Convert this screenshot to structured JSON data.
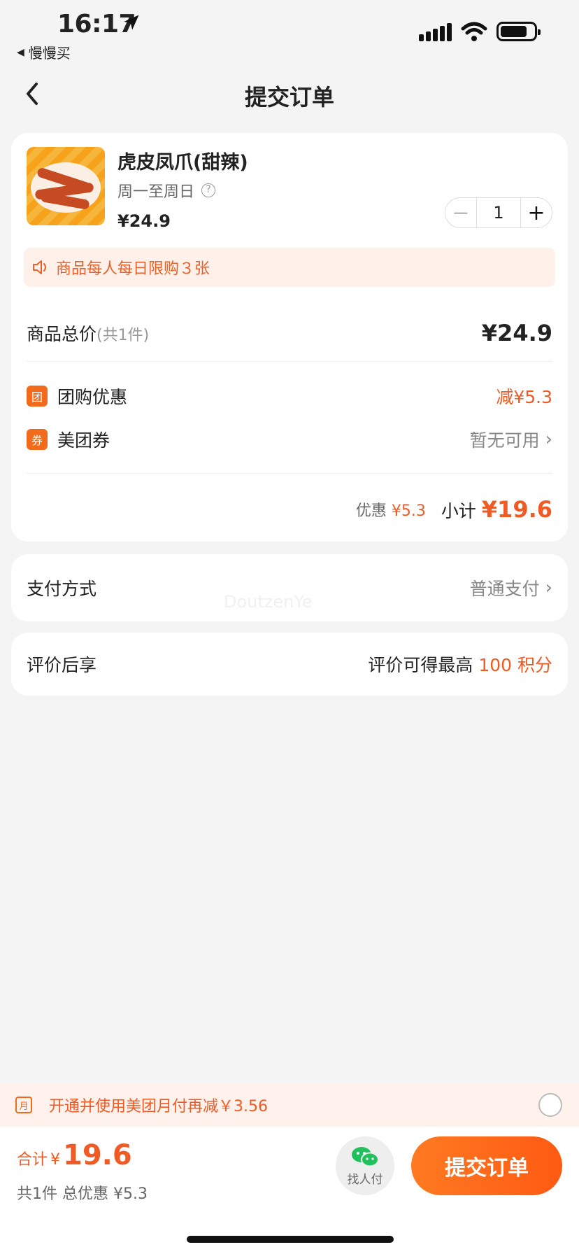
{
  "status_bar": {
    "time": "16:17",
    "back_app": "慢慢买"
  },
  "nav": {
    "title": "提交订单"
  },
  "product": {
    "name": "虎皮凤爪(甜辣)",
    "validity": "周一至周日",
    "price": "¥24.9",
    "quantity": "1",
    "limit_notice": "商品每人每日限购３张"
  },
  "summary": {
    "total_label": "商品总价",
    "total_count": "(共1件)",
    "total_value": "¥24.9",
    "group_icon": "团",
    "group_label": "团购优惠",
    "group_value": "减¥5.3",
    "coupon_icon": "券",
    "coupon_label": "美团券",
    "coupon_value": "暂无可用",
    "discount_label": "优惠",
    "discount_value": "¥5.3",
    "subtotal_label": "小计",
    "subtotal_value": "¥19.6"
  },
  "payment": {
    "label": "支付方式",
    "value": "普通支付"
  },
  "review": {
    "label": "评价后享",
    "value_prefix": "评价可得最高",
    "value_highlight": "100 积分"
  },
  "watermark": "DoutzenYe",
  "promo": {
    "icon": "月",
    "text": "开通并使用美团月付再减￥3.56"
  },
  "bottom": {
    "total_label": "合计",
    "currency": "¥",
    "total_value": "19.6",
    "summary": "共1件  总优惠 ¥5.3",
    "pay_friend": "找人付",
    "submit": "提交订单"
  },
  "colors": {
    "accent": "#f05a24",
    "button": "#ff6a1a",
    "background": "#f4f4f4"
  }
}
